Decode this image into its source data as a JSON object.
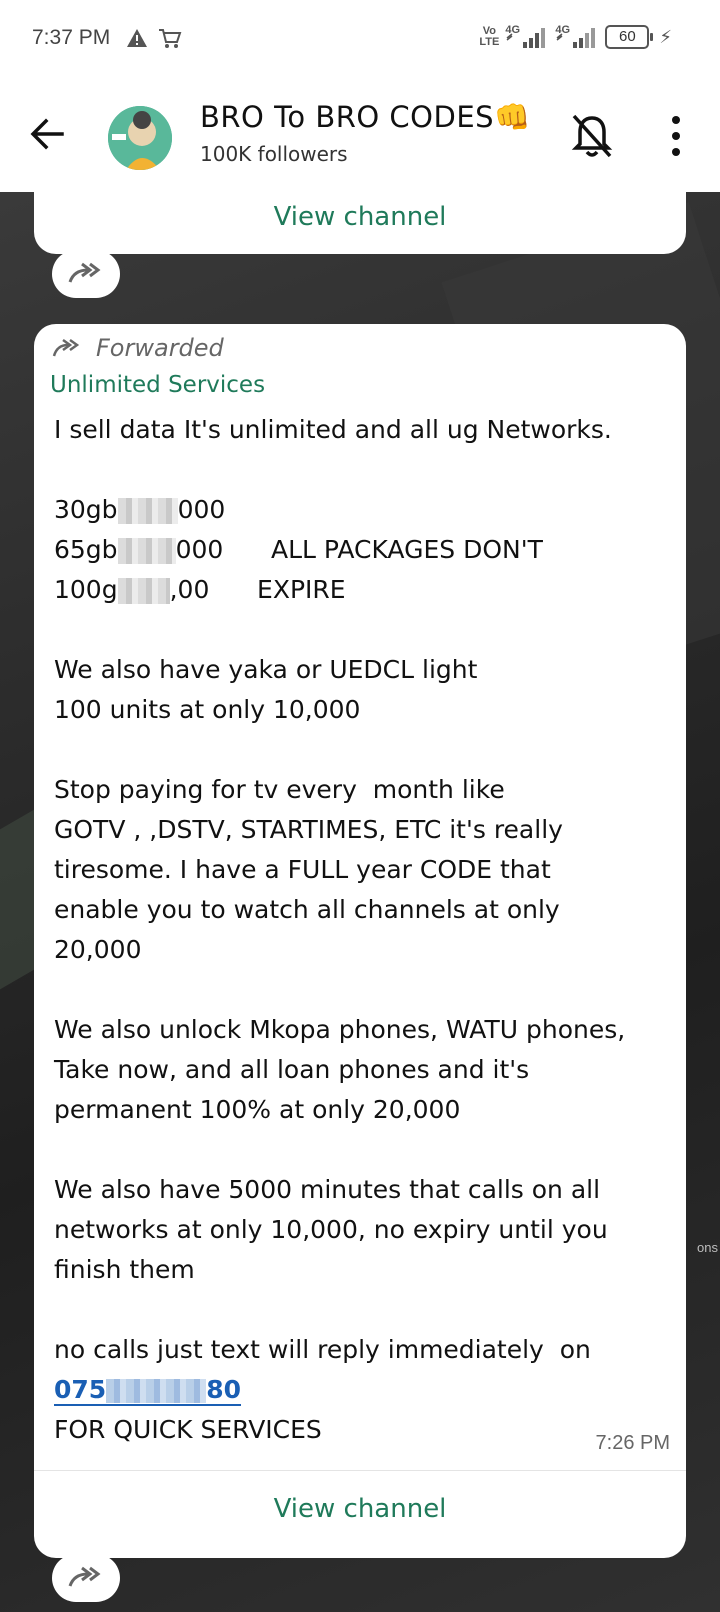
{
  "status_bar": {
    "time": "7:37 PM",
    "volte_top": "Vo",
    "volte_bottom": "LTE",
    "net1": "4G",
    "net2": "4G",
    "battery": "60"
  },
  "header": {
    "title": "BRO To BRO CODES👊",
    "followers": "100K followers"
  },
  "top_card": {
    "view_channel": "View channel"
  },
  "message": {
    "forwarded_label": "Forwarded",
    "sender": "Unlimited Services",
    "lines": [
      "I sell data It's unlimited and all ug Networks.",
      "",
      "30gb",
      "000",
      "65gb",
      "000      ALL PACKAGES DON'T",
      "100g",
      ",00      EXPIRE",
      "",
      "We also have yaka or UEDCL light",
      "100 units at only 10,000",
      "",
      "Stop paying for tv every  month like",
      "GOTV , ,DSTV, STARTIMES, ETC it's really",
      "tiresome. I have a FULL year CODE that",
      "enable you to watch all channels at only",
      "20,000",
      "",
      "We also unlock Mkopa phones, WATU phones,",
      "Take now, and all loan phones and it's",
      "permanent 100% at only 20,000",
      "",
      "We also have 5000 minutes that calls on all",
      "networks at only 10,000, no expiry until you",
      "finish them",
      "",
      "no calls just text will reply immediately  on"
    ],
    "phone_start": "075",
    "phone_end": "80",
    "last_line": "FOR QUICK SERVICES",
    "time": "7:26 PM",
    "view_channel": "View channel"
  },
  "side_label": "ons"
}
